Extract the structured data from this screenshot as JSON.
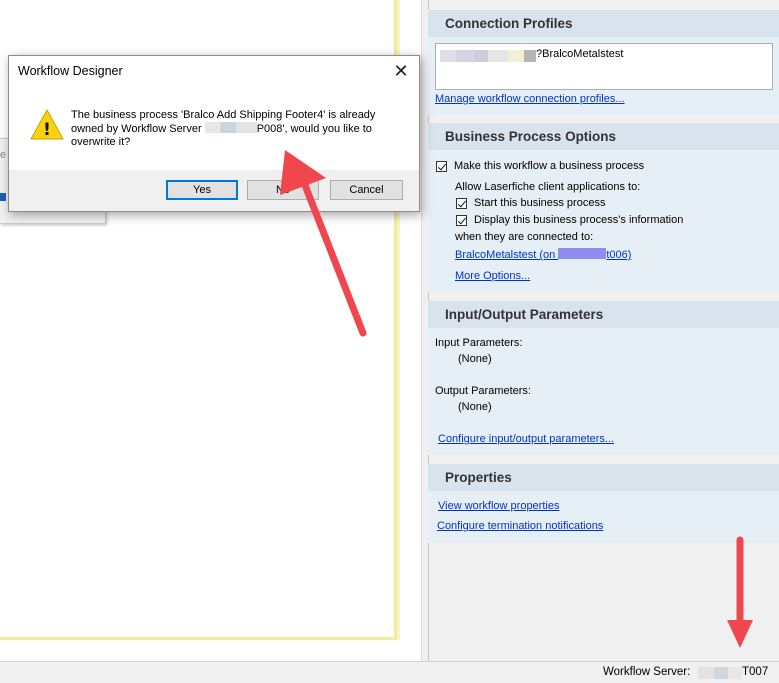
{
  "dialog": {
    "title": "Workflow Designer",
    "message_part1": "The business process 'Bralco Add Shipping Footer4' is already owned by Workflow Server ",
    "message_part2": "P008', would you like to overwrite it?",
    "buttons": {
      "yes": "Yes",
      "no": "No",
      "cancel": "Cancel"
    },
    "close_glyph": "✕",
    "warning_glyph": "!"
  },
  "connection_profiles": {
    "header": "Connection Profiles",
    "profile_text": "?BralcoMetalstest",
    "manage_link": "Manage workflow connection profiles..."
  },
  "business_process_options": {
    "header": "Business Process Options",
    "make_business_process": "Make this workflow a business process",
    "allow_label": "Allow Laserfiche client applications to:",
    "start_process": "Start this business process",
    "display_info": "Display this business process's information",
    "connected_label": "when they are connected to:",
    "repository_link_part1": "BralcoMetalstest (on ",
    "repository_link_part2": "t006)",
    "more_options": "More Options..."
  },
  "io_parameters": {
    "header": "Input/Output Parameters",
    "input_label": "Input Parameters:",
    "input_value": "(None)",
    "output_label": "Output Parameters:",
    "output_value": "(None)",
    "configure_link": "Configure input/output parameters..."
  },
  "properties": {
    "header": "Properties",
    "view_link": "View workflow properties",
    "termination_link": "Configure termination notifications"
  },
  "status_bar": {
    "server_label": "Workflow Server:",
    "server_suffix": "T007"
  },
  "colors": {
    "section_header": "#d9e3ee",
    "section_body": "#e6eef6",
    "link": "#0033cc",
    "arrow": "#f0464e",
    "canvas_border": "#f0ed9a",
    "default_button_border": "#0078d7"
  }
}
